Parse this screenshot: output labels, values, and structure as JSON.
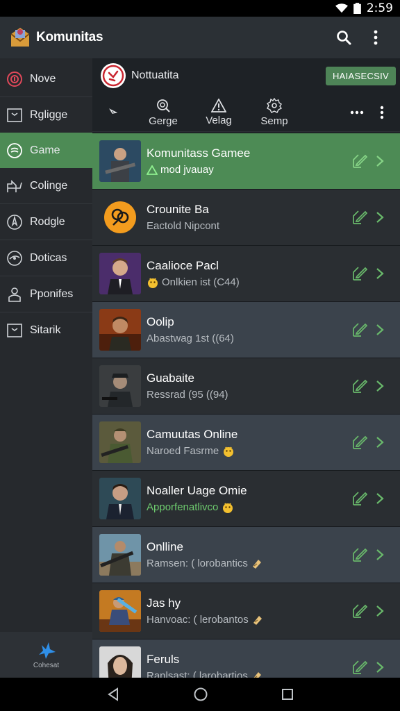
{
  "status_bar": {
    "time": "2:59"
  },
  "app_bar": {
    "title": "Komunitas"
  },
  "sidebar": {
    "items": [
      {
        "label": "Nove",
        "icon": "target-icon"
      },
      {
        "label": "Rgligge",
        "icon": "box-icon"
      },
      {
        "label": "Game",
        "icon": "game-icon",
        "active": true
      },
      {
        "label": "Colinge",
        "icon": "chart-icon"
      },
      {
        "label": "Rodgle",
        "icon": "compass-icon"
      },
      {
        "label": "Doticas",
        "icon": "eye-icon"
      },
      {
        "label": "Pponifes",
        "icon": "person-icon"
      },
      {
        "label": "Sitarik",
        "icon": "box-icon"
      }
    ],
    "footer_label": "Cohesat"
  },
  "community": {
    "name": "Nottuatita",
    "badge": "HAIASECSIV"
  },
  "toolbar": {
    "buttons": [
      {
        "label": "Gerge",
        "icon": "search-icon"
      },
      {
        "label": "Velag",
        "icon": "warning-icon"
      },
      {
        "label": "Semp",
        "icon": "settings-icon"
      }
    ]
  },
  "list": [
    {
      "title": "Komunitass Gamee",
      "subtitle": "mod jvauay",
      "sub_icon": "warning-icon",
      "style": "selected"
    },
    {
      "title": "Crounite Ba",
      "subtitle": "Eactold Nipcont",
      "style": "dark"
    },
    {
      "title": "Caalioce Pacl",
      "subtitle": "Onlkien ist (C44)",
      "sub_icon": "emoji-icon",
      "style": "dark"
    },
    {
      "title": "Oolip",
      "subtitle": "Abastwag 1st ((64)",
      "style": "alt"
    },
    {
      "title": "Guabaite",
      "subtitle": "Ressrad (95 ((94)",
      "style": "dark"
    },
    {
      "title": "Camuutas Online",
      "subtitle": "Naroed Fasrme",
      "sub_icon_after": "emoji-icon",
      "style": "alt"
    },
    {
      "title": "Noaller Uage Omie",
      "subtitle": "Apporfenatlivco",
      "sub_icon_after": "emoji-icon",
      "style": "dark",
      "green": true
    },
    {
      "title": "Onlline",
      "subtitle": "Ramsen: ( lorobantics",
      "sub_icon_after": "ticket-icon",
      "style": "alt"
    },
    {
      "title": "Jas hy",
      "subtitle": "Hanvoac: ( lerobantos",
      "sub_icon_after": "ticket-icon",
      "style": "dark"
    },
    {
      "title": "Feruls",
      "subtitle": "Ranlsast: ( larobartios",
      "sub_icon_after": "ticket-icon",
      "style": "alt"
    }
  ],
  "colors": {
    "accent": "#4d8b55",
    "appbar": "#2b3035",
    "sidebar": "#26292d",
    "row_alt": "#3b434c",
    "row_dark": "#2a2e32"
  }
}
